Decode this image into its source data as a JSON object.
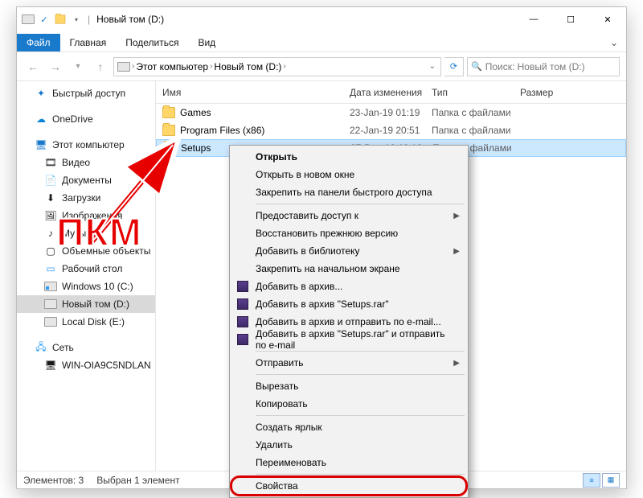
{
  "window": {
    "title": "Новый том (D:)"
  },
  "ribbon": {
    "file": "Файл",
    "tabs": [
      "Главная",
      "Поделиться",
      "Вид"
    ]
  },
  "nav": {
    "crumb_root": "Этот компьютер",
    "crumb_drive": "Новый том (D:)"
  },
  "search": {
    "placeholder": "Поиск: Новый том (D:)"
  },
  "sidebar": {
    "quick_access": "Быстрый доступ",
    "onedrive": "OneDrive",
    "this_pc": "Этот компьютер",
    "video": "Видео",
    "documents": "Документы",
    "downloads": "Загрузки",
    "pictures": "Изображения",
    "music": "Музыка",
    "objects3d": "Объемные объекты",
    "desktop": "Рабочий стол",
    "drive_c": "Windows 10 (C:)",
    "drive_d": "Новый том (D:)",
    "drive_e": "Local Disk (E:)",
    "network": "Сеть",
    "net_pc": "WIN-OIA9C5NDLAN"
  },
  "columns": {
    "name": "Имя",
    "date": "Дата изменения",
    "type": "Тип",
    "size": "Размер"
  },
  "rows": [
    {
      "name": "Games",
      "date": "23-Jan-19 01:19",
      "type": "Папка с файлами"
    },
    {
      "name": "Program Files (x86)",
      "date": "22-Jan-19 20:51",
      "type": "Папка с файлами"
    },
    {
      "name": "Setups",
      "date": "27-Dec-18 19:13",
      "type": "Папка с файлами"
    }
  ],
  "ctx": {
    "open": "Открыть",
    "open_new": "Открыть в новом окне",
    "pin_qa": "Закрепить на панели быстрого доступа",
    "grant_access": "Предоставить доступ к",
    "restore_prev": "Восстановить прежнюю версию",
    "add_lib": "Добавить в библиотеку",
    "pin_start": "Закрепить на начальном экране",
    "rar_add": "Добавить в архив...",
    "rar_add_name": "Добавить в архив \"Setups.rar\"",
    "rar_email": "Добавить в архив и отправить по e-mail...",
    "rar_email_name": "Добавить в архив \"Setups.rar\" и отправить по e-mail",
    "send_to": "Отправить",
    "cut": "Вырезать",
    "copy": "Копировать",
    "shortcut": "Создать ярлык",
    "delete": "Удалить",
    "rename": "Переименовать",
    "properties": "Свойства"
  },
  "status": {
    "count": "Элементов: 3",
    "sel": "Выбран 1 элемент"
  },
  "annotation": {
    "label": "ПКМ"
  }
}
